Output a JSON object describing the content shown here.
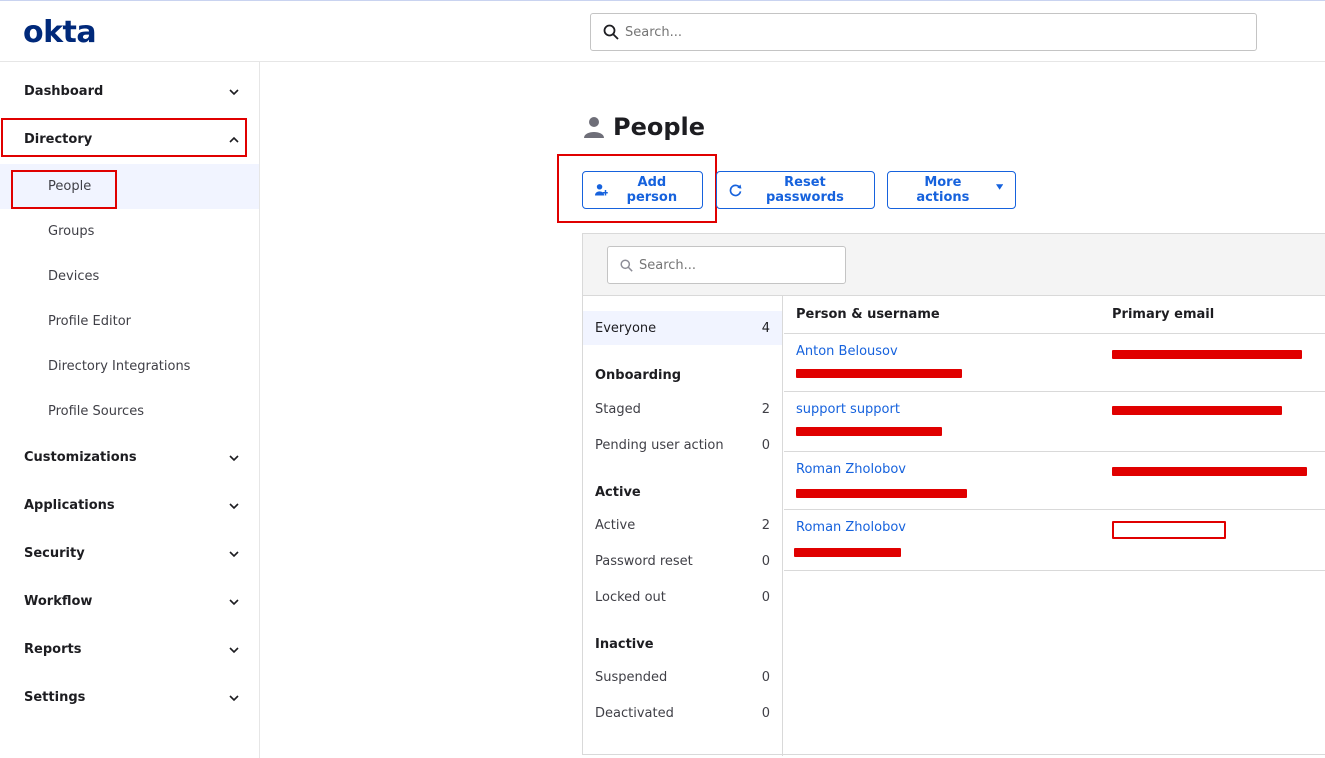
{
  "brand": {
    "logo_text": "okta"
  },
  "top_search": {
    "placeholder": "Search..."
  },
  "sidebar": {
    "dashboard": "Dashboard",
    "directory": "Directory",
    "directory_items": [
      "People",
      "Groups",
      "Devices",
      "Profile Editor",
      "Directory Integrations",
      "Profile Sources"
    ],
    "customizations": "Customizations",
    "applications": "Applications",
    "security": "Security",
    "workflow": "Workflow",
    "reports": "Reports",
    "settings": "Settings"
  },
  "page": {
    "title": "People",
    "add_person": "Add person",
    "reset_passwords": "Reset passwords",
    "more_actions": "More actions"
  },
  "panel": {
    "search_placeholder": "Search...",
    "filters": {
      "everyone": {
        "label": "Everyone",
        "count": "4"
      },
      "onboarding_heading": "Onboarding",
      "staged": {
        "label": "Staged",
        "count": "2"
      },
      "pending": {
        "label": "Pending user action",
        "count": "0"
      },
      "active_heading": "Active",
      "active": {
        "label": "Active",
        "count": "2"
      },
      "password_reset": {
        "label": "Password reset",
        "count": "0"
      },
      "locked_out": {
        "label": "Locked out",
        "count": "0"
      },
      "inactive_heading": "Inactive",
      "suspended": {
        "label": "Suspended",
        "count": "0"
      },
      "deactivated": {
        "label": "Deactivated",
        "count": "0"
      }
    },
    "columns": {
      "person": "Person & username",
      "email": "Primary email"
    },
    "rows": [
      {
        "name": "Anton Belousov"
      },
      {
        "name": "support support"
      },
      {
        "name": "Roman Zholobov"
      },
      {
        "name": "Roman Zholobov"
      }
    ]
  },
  "colors": {
    "accent": "#1662dd",
    "brand": "#00297a",
    "annotation": "#e00000"
  }
}
